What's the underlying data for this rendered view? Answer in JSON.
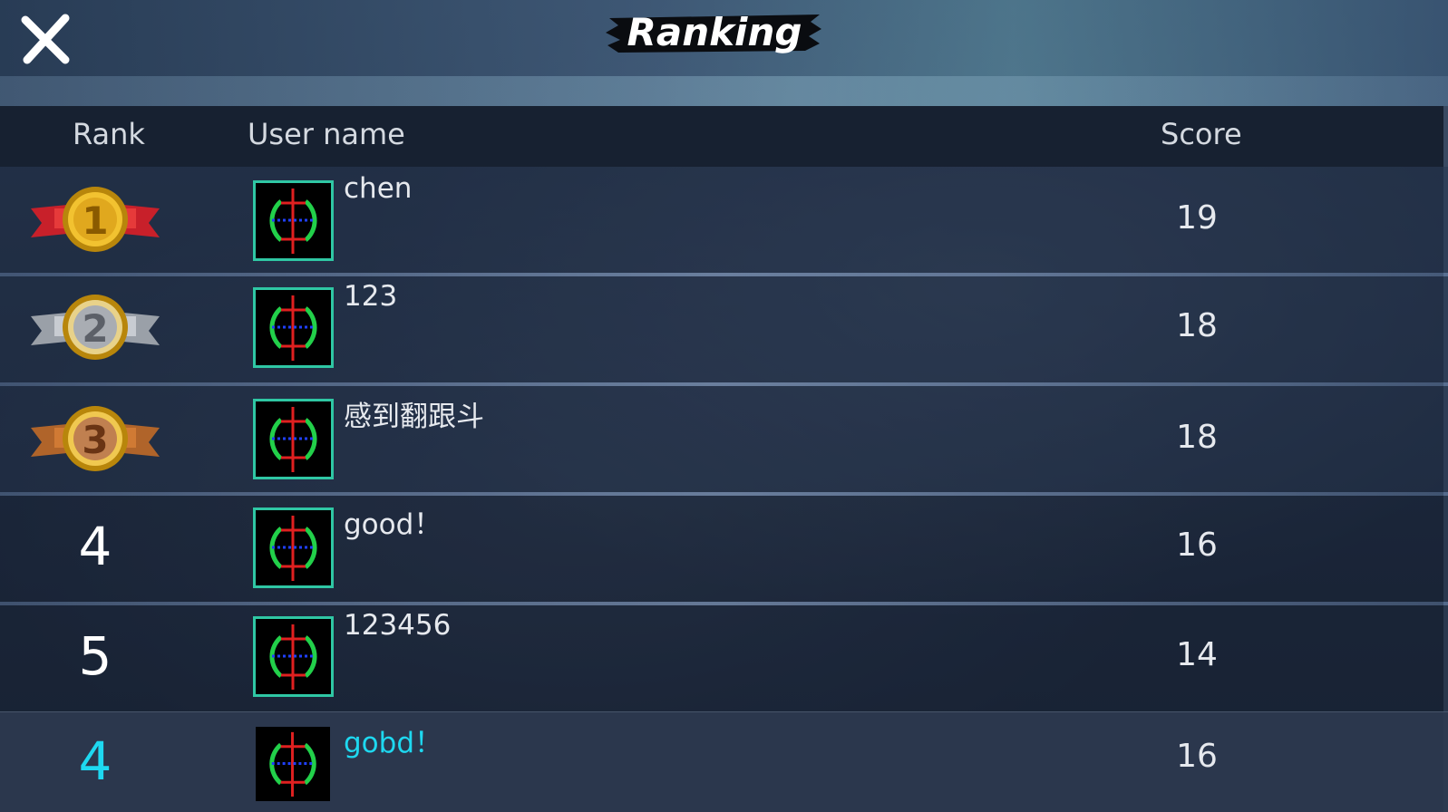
{
  "title": "Ranking",
  "header": {
    "rank": "Rank",
    "user_name": "User name",
    "score": "Score"
  },
  "rows": [
    {
      "rank": "1",
      "rank_display": "medal-gold",
      "name": "chen",
      "score": "19"
    },
    {
      "rank": "2",
      "rank_display": "medal-silver",
      "name": "123",
      "score": "18"
    },
    {
      "rank": "3",
      "rank_display": "medal-bronze",
      "name": "感到翻跟斗",
      "score": "18"
    },
    {
      "rank": "4",
      "rank_display": "number",
      "name": "good！",
      "score": "16"
    },
    {
      "rank": "5",
      "rank_display": "number",
      "name": "123456",
      "score": "14"
    }
  ],
  "me": {
    "rank": "4",
    "name": "gobd！",
    "score": "16"
  },
  "colors": {
    "accent": "#1ed8f0",
    "avatar_border": "#2fc7a4",
    "header_bg": "#172131"
  },
  "icons": {
    "close": "close-icon",
    "avatar": "crosshair-avatar-icon",
    "medal": "medal-icon"
  }
}
